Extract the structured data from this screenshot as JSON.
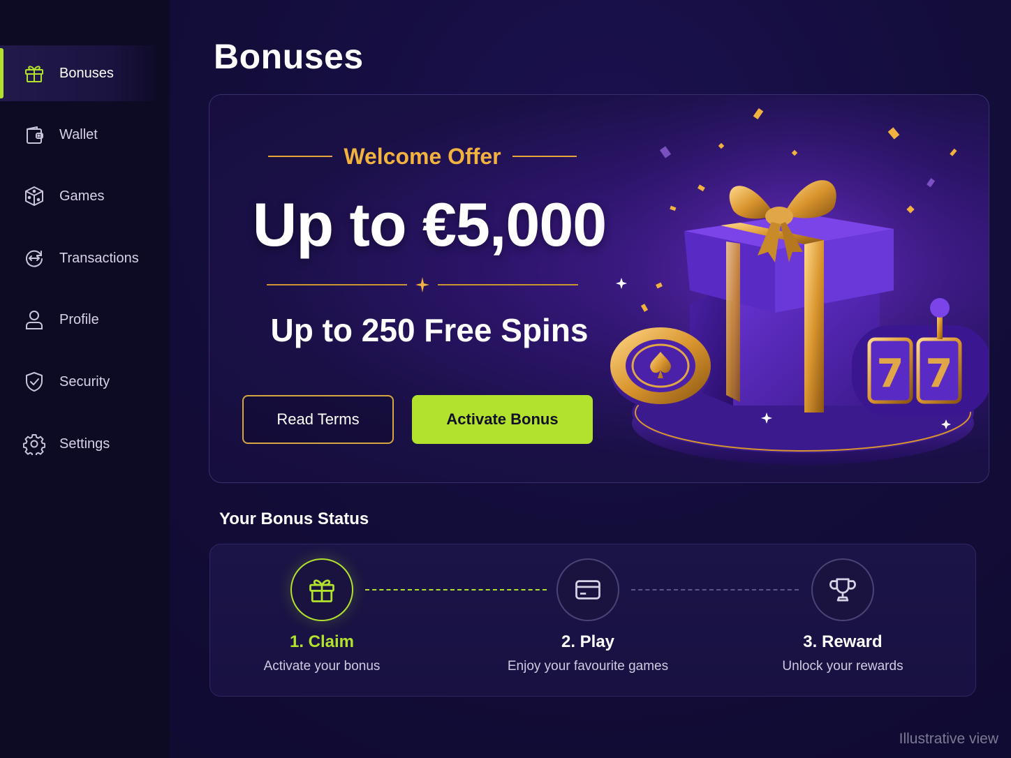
{
  "sidebar": {
    "items": [
      {
        "label": "Bonuses",
        "icon": "gift-icon",
        "active": true
      },
      {
        "label": "Wallet",
        "icon": "wallet-icon",
        "active": false
      },
      {
        "label": "Games",
        "icon": "dice-icon",
        "active": false
      },
      {
        "label": "Transactions",
        "icon": "transactions-icon",
        "active": false
      },
      {
        "label": "Profile",
        "icon": "user-icon",
        "active": false
      },
      {
        "label": "Security",
        "icon": "shield-icon",
        "active": false
      },
      {
        "label": "Settings",
        "icon": "gear-icon",
        "active": false
      }
    ]
  },
  "page": {
    "title": "Bonuses"
  },
  "hero": {
    "eyebrow": "Welcome Offer",
    "amount": "Up to €5,000",
    "spins": "Up to 250 Free Spins",
    "terms_label": "Read Terms",
    "activate_label": "Activate Bonus"
  },
  "status": {
    "title": "Your Bonus Status",
    "steps": [
      {
        "title": "1. Claim",
        "subtitle": "Activate your bonus",
        "icon": "gift-icon",
        "active": true
      },
      {
        "title": "2. Play",
        "subtitle": "Enjoy your favourite games",
        "icon": "card-icon",
        "active": false
      },
      {
        "title": "3. Reward",
        "subtitle": "Unlock your rewards",
        "icon": "trophy-icon",
        "active": false
      }
    ]
  },
  "footer": {
    "watermark": "Illustrative view"
  },
  "colors": {
    "accent": "#b2e22e",
    "gold": "#f2b23f",
    "background": "#0f0a2e"
  }
}
